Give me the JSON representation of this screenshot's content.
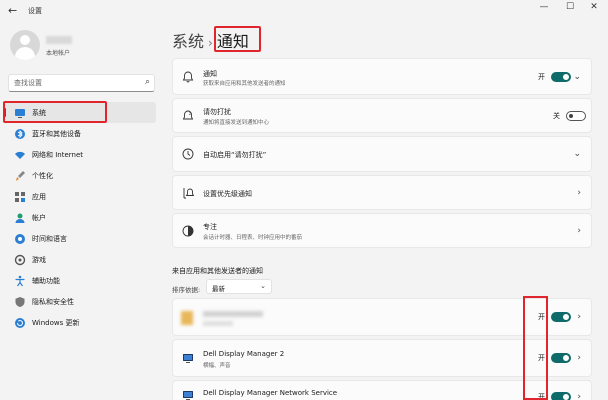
{
  "window": {
    "back_icon": "back-arrow-icon",
    "title": "设置",
    "controls": [
      "minimize-icon",
      "maximize-icon",
      "close-icon"
    ]
  },
  "user": {
    "account_type": "本地帐户"
  },
  "search": {
    "placeholder": "查找设置"
  },
  "sidebar": {
    "items": [
      {
        "label": "系统",
        "icon": "system-icon",
        "active": true
      },
      {
        "label": "蓝牙和其他设备",
        "icon": "bluetooth-icon"
      },
      {
        "label": "网络和 Internet",
        "icon": "wifi-icon"
      },
      {
        "label": "个性化",
        "icon": "brush-icon"
      },
      {
        "label": "应用",
        "icon": "apps-icon"
      },
      {
        "label": "帐户",
        "icon": "account-icon"
      },
      {
        "label": "时间和语言",
        "icon": "globe-icon"
      },
      {
        "label": "游戏",
        "icon": "gaming-icon"
      },
      {
        "label": "辅助功能",
        "icon": "accessibility-icon"
      },
      {
        "label": "隐私和安全性",
        "icon": "shield-icon"
      },
      {
        "label": "Windows 更新",
        "icon": "update-icon"
      }
    ]
  },
  "breadcrumb": {
    "parent": "系统",
    "separator": "›",
    "current": "通知"
  },
  "settings": {
    "notifications": {
      "title": "通知",
      "subtitle": "获取来自应用和其他发送者的通知",
      "state": "开",
      "on": true,
      "icon": "bell-icon"
    },
    "dnd": {
      "title": "请勿打扰",
      "subtitle": "通知将直接发送到通知中心",
      "state": "关",
      "on": false,
      "icon": "bell-snooze-icon"
    },
    "auto_dnd": {
      "title": "自动启用“请勿打扰”",
      "icon": "clock-icon"
    },
    "priority": {
      "title": "设置优先级通知",
      "icon": "priority-bell-icon"
    },
    "focus": {
      "title": "专注",
      "subtitle": "会话计时器、日程表、时钟应用中的番茄",
      "icon": "focus-icon"
    }
  },
  "senders": {
    "section_title": "来自应用和其他发送者的通知",
    "sort_label": "排序依据:",
    "sort_value": "最新",
    "items": [
      {
        "name": "",
        "detail": "",
        "state": "开",
        "on": true
      },
      {
        "name": "Dell Display Manager 2",
        "detail": "横幅、声音",
        "state": "开",
        "on": true,
        "icon": "display-app-icon"
      },
      {
        "name": "Dell Display Manager Network Service",
        "detail": "",
        "state": "开",
        "on": true,
        "icon": "display-app-icon"
      }
    ]
  },
  "colors": {
    "accent": "#0067c0",
    "toggle_on": "#0f6a6a",
    "annotation_red": "#e0262c"
  }
}
